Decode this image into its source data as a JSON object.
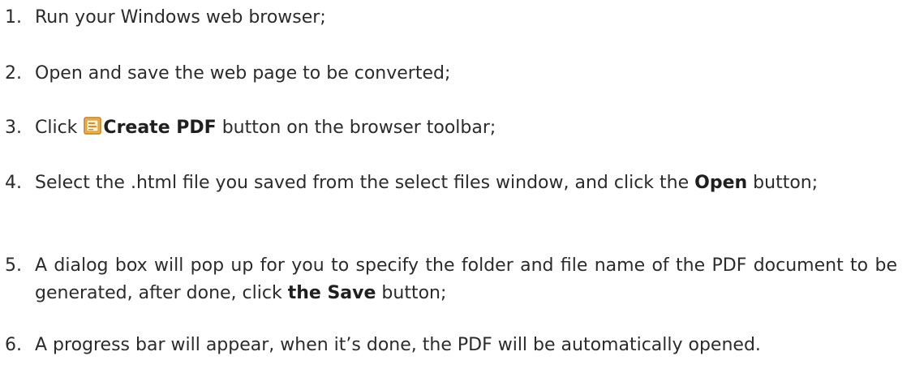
{
  "steps": [
    {
      "number": "1.",
      "text": "Run your Windows web browser;"
    },
    {
      "number": "2.",
      "text": "Open and save the web page to be converted;"
    },
    {
      "number": "3.",
      "pre": "Click",
      "icon": "create-pdf-icon",
      "bold": "Create PDF",
      "post": " button on the browser toolbar;"
    },
    {
      "number": "4.",
      "pre": "Select the .html file you saved from the select files window, and click the ",
      "bold": "Open",
      "post": " button;"
    },
    {
      "number": "5.",
      "pre": "A dialog box will pop up for you to specify the folder and file name of the PDF document to be generated, after done, click ",
      "bold": "the Save",
      "post": " button;"
    },
    {
      "number": "6.",
      "text": "A progress bar will appear, when it’s done, the PDF will be automatically opened."
    }
  ],
  "colors": {
    "text": "#2b2b2b",
    "icon_frame": "#e0a23a",
    "icon_fill": "#fff4d6"
  }
}
